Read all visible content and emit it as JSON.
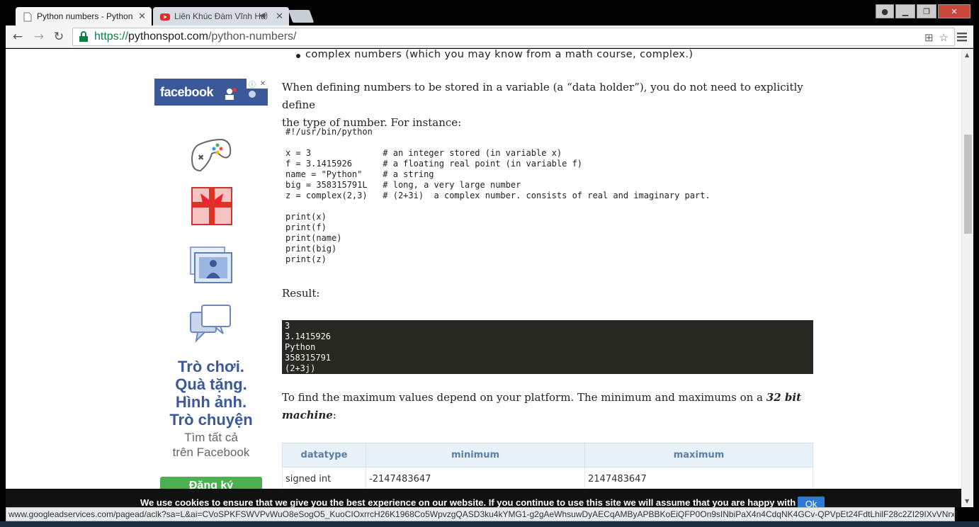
{
  "browser": {
    "tabs": [
      {
        "title": "Python numbers - Python",
        "active": true
      },
      {
        "title": "Liên Khúc Đàm Vĩnh Hư",
        "active": false
      }
    ],
    "url_scheme": "https://",
    "url_host": "pythonspot.com",
    "url_path": "/python-numbers/",
    "status_url": "www.googleadservices.com/pagead/aclk?sa=L&ai=CVoSPKFSWVPvWuO8eSogO5_KuoCIOxrrcH26K1968Co5WpvzgQASD3ku4kYMG1-g2gAeWhsuwDyAECqAMByAPBBKoEiQFP0On9sINbiPaX4n4CdqNK4GCv-QPVpEt24FdtLhilF28c2ZI29IXvVNrx35-a5Ibi..."
  },
  "ad": {
    "brand": "facebook",
    "headline_lines": [
      "Trò chơi.",
      "Quà tặng.",
      "Hình ảnh.",
      "Trò chuyện"
    ],
    "sub_lines": [
      "Tìm tất cả",
      "trên Facebook"
    ],
    "button_label": "Đăng ký"
  },
  "article": {
    "bullet": "complex numbers (which you may know from a math course, complex.)",
    "intro_line1": "When defining numbers to be stored in a variable (a “data holder”), you do not need to explicitly define",
    "intro_line2": "the type of number. For instance:",
    "code_lines": [
      "#!/usr/bin/python",
      "",
      "x = 3              # an integer stored (in variable x)",
      "f = 3.1415926      # a floating real point (in variable f)",
      "name = \"Python\"    # a string",
      "big = 358315791L   # long, a very large number",
      "z = complex(2,3)   # (2+3i)  a complex number. consists of real and imaginary part.",
      "",
      "print(x)",
      "print(f)",
      "print(name)",
      "print(big)",
      "print(z)"
    ],
    "result_label": "Result:",
    "result_lines": [
      "3",
      "3.1415926",
      "Python",
      "358315791",
      "(2+3j)"
    ],
    "max_line1": "To find the maximum values depend on your platform. The minimum and maximums on a",
    "max_emph1": "32 bit",
    "max_emph2": "machine",
    "max_colon": ":",
    "table": {
      "headers": [
        "datatype",
        "minimum",
        "maximum"
      ],
      "rows": [
        [
          "signed int",
          "-2147483647",
          "2147483647"
        ]
      ]
    }
  },
  "cookie": {
    "text": "We use cookies to ensure that we give you the best experience on our website. If you continue to use this site we will assume that you are happy with it.",
    "ok_label": "Ok"
  },
  "colors": {
    "facebook_blue": "#3b5998",
    "code_bg": "#272822",
    "https_green": "#0b8043",
    "ok_button": "#2a7ad6"
  }
}
